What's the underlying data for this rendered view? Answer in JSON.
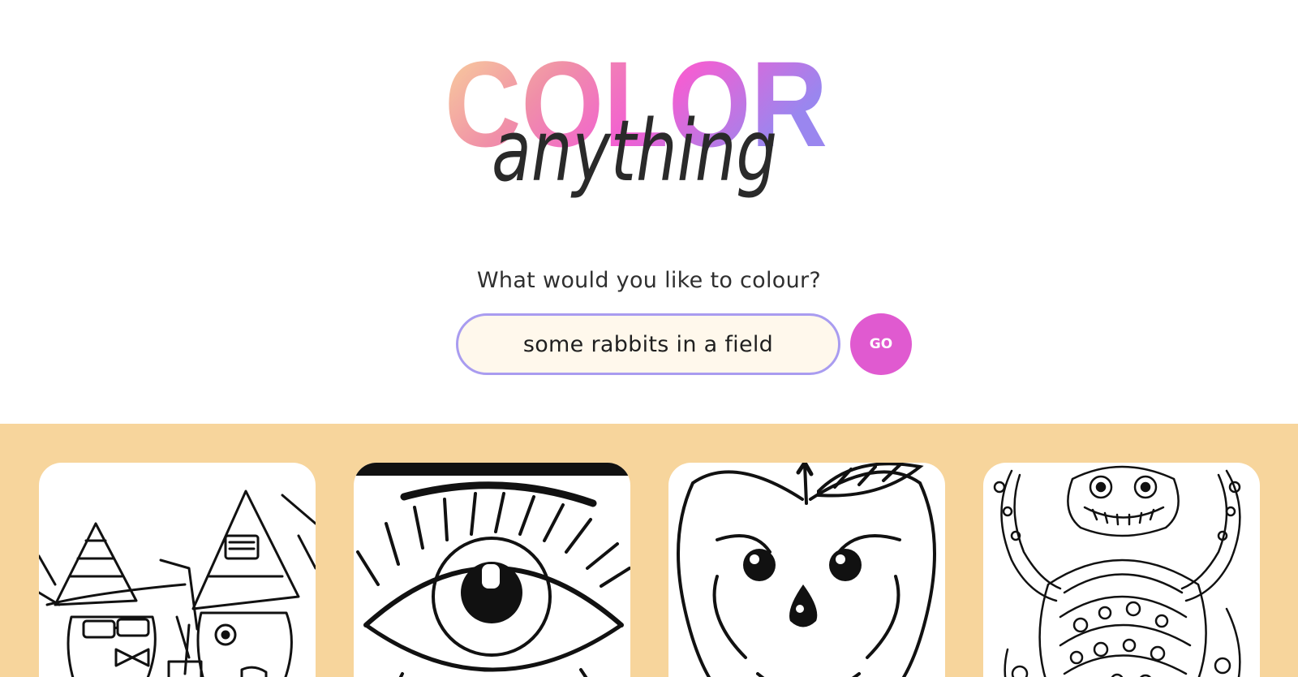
{
  "brand": {
    "logo_word_1": "COLOR",
    "logo_word_2": "anything",
    "gradient_colors": [
      "#f9d79a",
      "#f08fa8",
      "#f25fd3",
      "#9a86ef"
    ]
  },
  "search": {
    "prompt_label": "What would you like to colour?",
    "input_value": "some rabbits in a field",
    "go_label": "GO"
  },
  "colors": {
    "input_border": "#a99cf0",
    "input_background": "#fff8ec",
    "go_button": "#e05ad0",
    "gallery_background": "#f7d59c"
  },
  "gallery": {
    "items": [
      {
        "subject": "two-cats-in-wizard-hats"
      },
      {
        "subject": "eye-with-lashes"
      },
      {
        "subject": "smiling-apple"
      },
      {
        "subject": "patterned-monster"
      }
    ]
  }
}
